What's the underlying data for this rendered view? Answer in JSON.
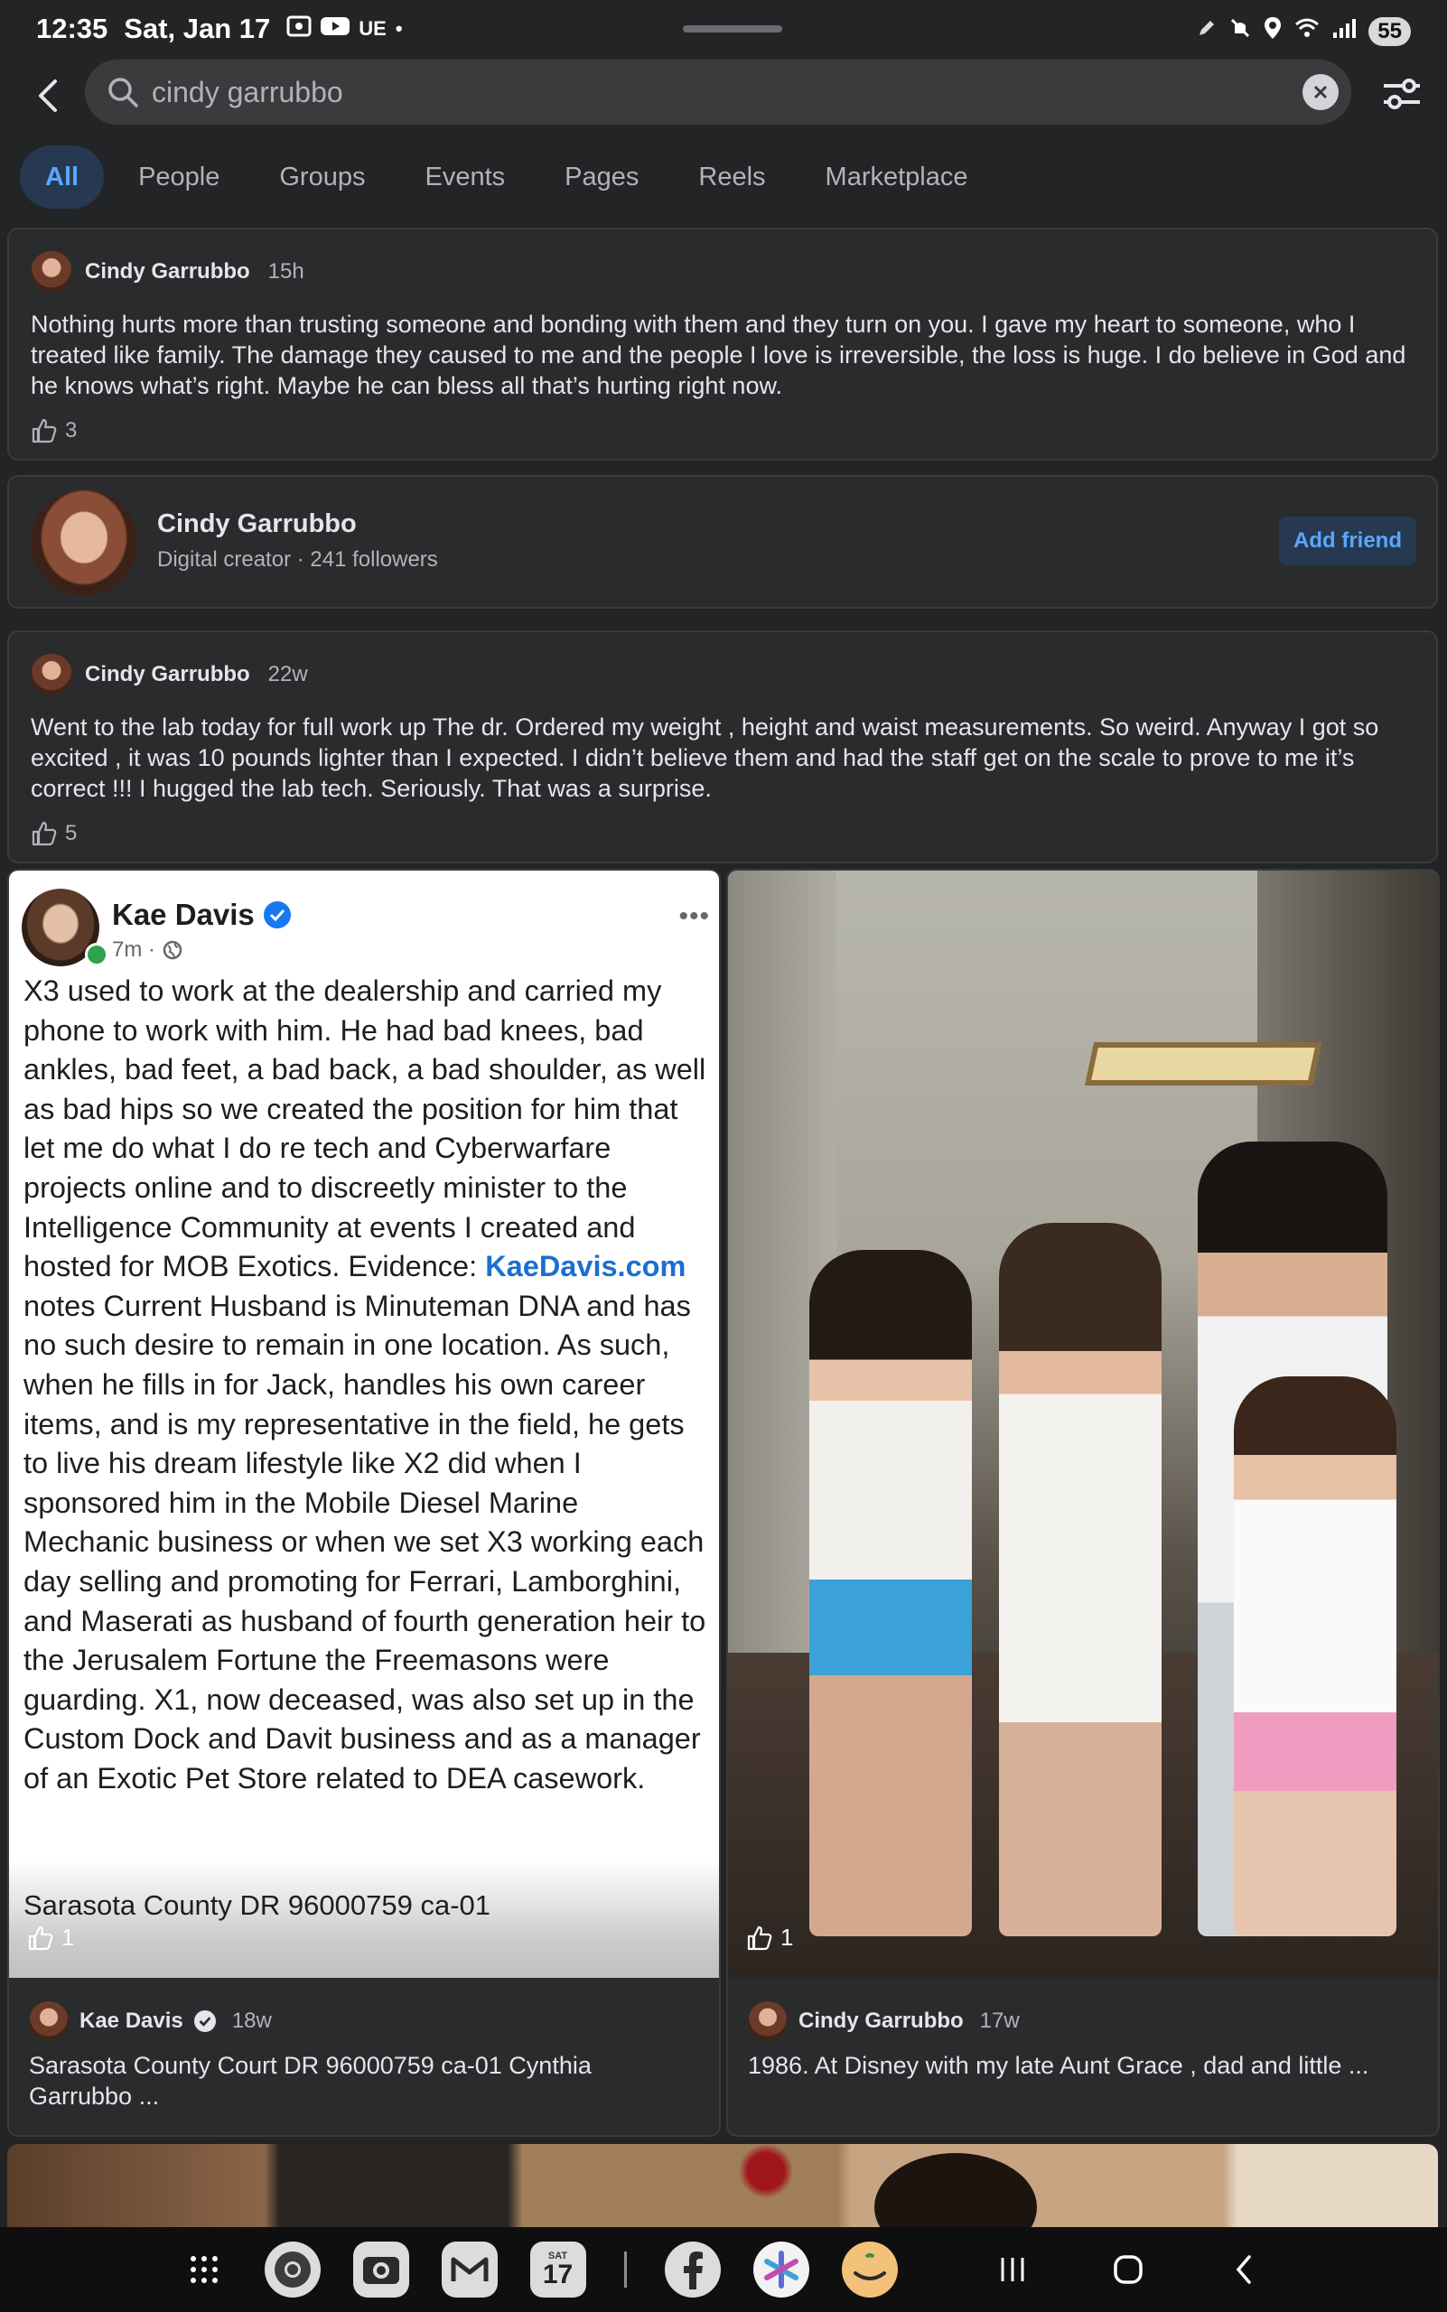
{
  "status_bar": {
    "time": "12:35",
    "date": "Sat, Jan 17",
    "carrier": "UE",
    "battery": "55",
    "icons": [
      "screen-record-icon",
      "youtube-icon",
      "dot-icon",
      "pen-icon",
      "mute-icon",
      "location-icon",
      "wifi-icon",
      "signal-icon",
      "battery-icon"
    ]
  },
  "search": {
    "query": "cindy garrubbo"
  },
  "tabs": [
    {
      "label": "All",
      "active": true
    },
    {
      "label": "People"
    },
    {
      "label": "Groups"
    },
    {
      "label": "Events"
    },
    {
      "label": "Pages"
    },
    {
      "label": "Reels"
    },
    {
      "label": "Marketplace"
    }
  ],
  "posts": [
    {
      "author": "Cindy Garrubbo",
      "time": "15h",
      "text": "Nothing hurts more than trusting someone and bonding with them and they turn on you. I gave my heart to someone, who I treated like family. The damage they caused to me and the people I love is irreversible, the loss is huge. I do believe in God and he knows what’s right. Maybe he can bless all that’s hurting right now.",
      "likes": "3"
    },
    {
      "author": "Cindy Garrubbo",
      "time": "22w",
      "text": "Went to the lab today for full work up  The dr. Ordered my weight , height and waist measurements. So weird. Anyway I got so excited , it was 10 pounds lighter than I expected. I didn’t believe them and had the staff get on the scale to prove to me it’s correct !!! I hugged the lab tech. Seriously. That was a surprise.",
      "likes": "5"
    }
  ],
  "profile": {
    "name": "Cindy Garrubbo",
    "subtitle": "Digital creator · 241 followers",
    "button": "Add friend"
  },
  "tile_left": {
    "shot": {
      "name": "Kae Davis",
      "meta": "7m ·",
      "more": "•••",
      "text_before_link": "X3 used to work at the dealership and carried my phone to work with him. He had bad knees, bad ankles, bad feet, a bad back, a bad shoulder, as well as bad hips so we created the position for him that let me do what I do re tech and Cyberwarfare projects online and to discreetly minister to the Intelligence Community at events I created and hosted for MOB Exotics. Evidence: ",
      "link": "KaeDavis.com",
      "text_after_link": " notes Current Husband is Minuteman DNA and has no such desire to remain in one location. As such, when he fills in for Jack, handles his own career items, and is my representative in the field, he gets to live his dream lifestyle like X2 did when I sponsored him in the Mobile Diesel Marine Mechanic business or when we set X3 working each day selling and promoting for Ferrari, Lamborghini, and Maserati as husband of fourth generation heir to the Jerusalem Fortune the Freemasons were guarding. X1, now deceased, was also set up in the Custom Dock and Davit business and as a manager of an Exotic Pet Store related to DEA casework.",
      "footer": "Sarasota County DR 96000759 ca-01"
    },
    "likes": "1",
    "author": "Kae Davis",
    "time": "18w",
    "caption": "Sarasota County Court DR 96000759 ca-01 Cynthia Garrubbo ..."
  },
  "tile_right": {
    "likes": "1",
    "author": "Cindy Garrubbo",
    "time": "17w",
    "caption": "1986. At Disney with my late Aunt Grace , dad and little ..."
  },
  "nav": {
    "apps": [
      "apps-grid-icon",
      "chrome-icon",
      "camera-icon",
      "gmail-icon",
      "calendar-icon",
      "facebook-icon",
      "perplexity-icon",
      "amazon-icon"
    ],
    "calendar_day": "SAT",
    "calendar_date": "17",
    "buttons": [
      "recents-button",
      "home-button",
      "back-button"
    ]
  },
  "colors": {
    "background": "#232426",
    "card": "#2a2b2d",
    "accent": "#5aa7ff",
    "active_tab_bg": "#263951"
  }
}
